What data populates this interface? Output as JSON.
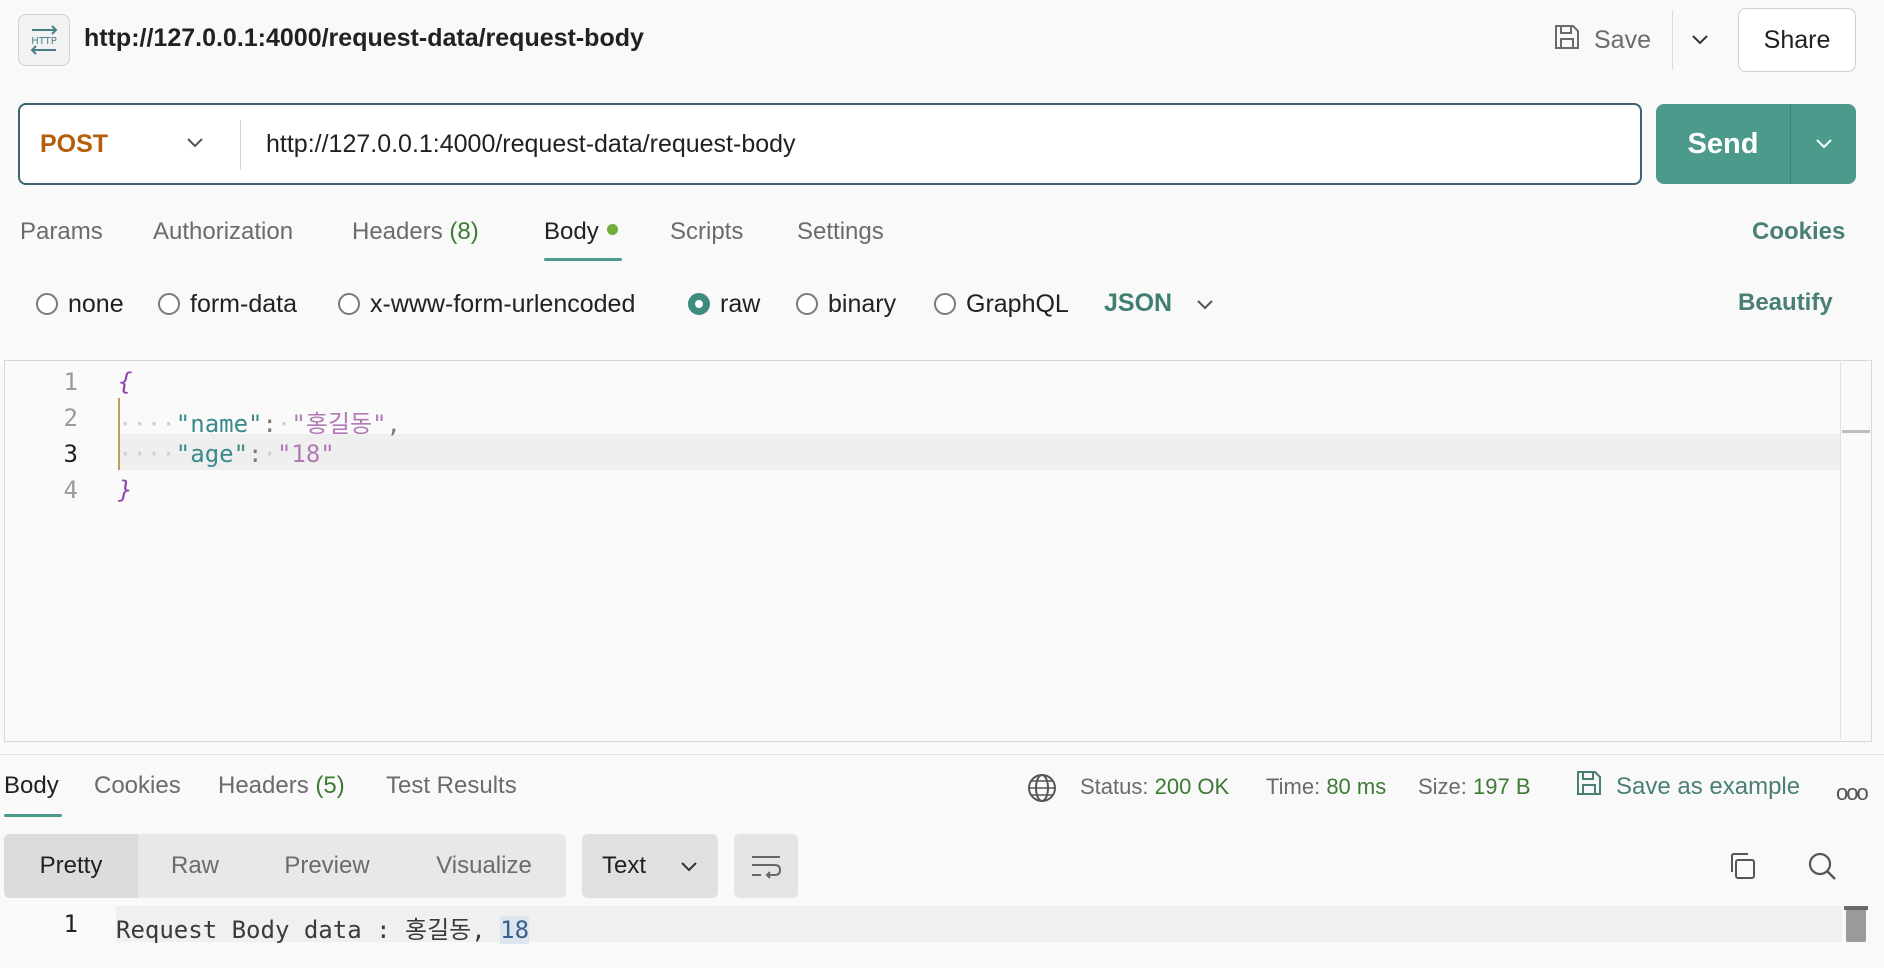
{
  "header": {
    "icon_label": "HTTP",
    "title": "http://127.0.0.1:4000/request-data/request-body",
    "save_label": "Save",
    "share_label": "Share"
  },
  "request": {
    "method": "POST",
    "url": "http://127.0.0.1:4000/request-data/request-body",
    "send_label": "Send"
  },
  "request_tabs": {
    "params": "Params",
    "authorization": "Authorization",
    "headers": "Headers",
    "headers_count": "(8)",
    "body": "Body",
    "scripts": "Scripts",
    "settings": "Settings",
    "cookies": "Cookies"
  },
  "body_types": {
    "none": "none",
    "form_data": "form-data",
    "urlencoded": "x-www-form-urlencoded",
    "raw": "raw",
    "binary": "binary",
    "graphql": "GraphQL",
    "selected": "raw",
    "format": "JSON",
    "beautify": "Beautify"
  },
  "editor": {
    "line_numbers": [
      "1",
      "2",
      "3",
      "4"
    ],
    "open_brace": "{",
    "close_brace": "}",
    "line2_key": "\"name\"",
    "line2_value": "\"홍길동\"",
    "line3_key": "\"age\"",
    "line3_value": "\"18\"",
    "current_line": 3
  },
  "response_tabs": {
    "body": "Body",
    "cookies": "Cookies",
    "headers": "Headers",
    "headers_count": "(5)",
    "test_results": "Test Results"
  },
  "response_meta": {
    "status_label": "Status:",
    "status_value": "200 OK",
    "time_label": "Time:",
    "time_value": "80 ms",
    "size_label": "Size:",
    "size_value": "197 B",
    "save_example": "Save as example"
  },
  "response_view": {
    "pretty": "Pretty",
    "raw": "Raw",
    "preview": "Preview",
    "visualize": "Visualize",
    "format": "Text"
  },
  "response_body": {
    "line_number": "1",
    "text": "Request Body data : 홍길동, ",
    "highlighted_value": "18"
  },
  "colors": {
    "accent": "#4c9a8b",
    "method": "#b45d0b",
    "status_ok": "#3d7a33"
  }
}
